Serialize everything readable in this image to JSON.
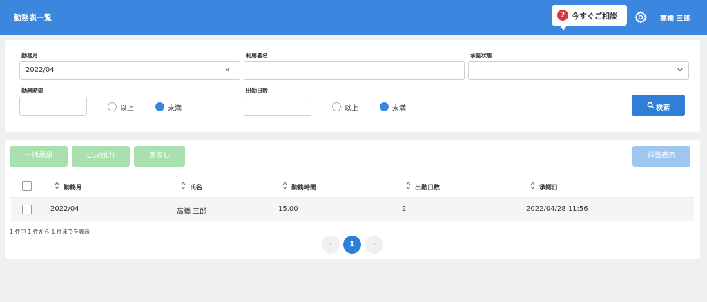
{
  "header": {
    "title": "勤務表一覧",
    "consult_icon": "?",
    "consult_label": "今すぐご相談",
    "settings_icon": "gear-icon",
    "user_name": "高橋 三郎",
    "bg_color": "#3b86de"
  },
  "search": {
    "month_label": "勤務月",
    "month_value": "2022/04",
    "clear_glyph": "×",
    "user_name_label": "利用者名",
    "user_name_value": "",
    "approval_label": "承認状態",
    "approval_value": "",
    "hours_label": "勤務時間",
    "hours_value": "",
    "hours_options": [
      "以上",
      "未満"
    ],
    "hours_selected": "未満",
    "days_label": "出勤日数",
    "days_value": "",
    "days_options": [
      "以上",
      "未満"
    ],
    "days_selected": "未満",
    "search_button": "検索"
  },
  "actions": {
    "bulk_approve": "一括承認",
    "csv_export": "CSV出力",
    "send_back": "差戻し",
    "details": "詳細表示"
  },
  "table": {
    "columns": [
      "勤務月",
      "氏名",
      "勤務時間",
      "出勤日数",
      "承認日"
    ],
    "rows": [
      {
        "month": "2022/04",
        "name": "高橋 三郎",
        "hours": "15.00",
        "days": "2",
        "approved": "2022/04/28 11:56"
      }
    ]
  },
  "pagination": {
    "summary": "1 件中 1 件から 1 件までを表示",
    "prev": "‹",
    "current": "1",
    "next": "›"
  }
}
